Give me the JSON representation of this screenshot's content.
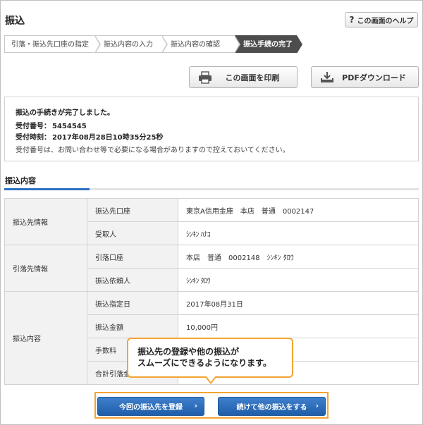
{
  "page": {
    "title": "振込"
  },
  "help": {
    "label": "この画面のヘルプ",
    "icon": "question-icon"
  },
  "steps": [
    {
      "label": "引落・振込先口座の指定",
      "active": false
    },
    {
      "label": "振込内容の入力",
      "active": false
    },
    {
      "label": "振込内容の確認",
      "active": false
    },
    {
      "label": "振込手続の完了",
      "active": true
    }
  ],
  "actions": {
    "print_label": "この画面を印刷",
    "pdf_label": "PDFダウンロード"
  },
  "completion": {
    "message": "振込の手続きが完了しました。",
    "receipt_no_label": "受付番号：",
    "receipt_no": "5454545",
    "receipt_time_label": "受付時刻：",
    "receipt_time": "2017年08月28日10時35分25秒",
    "note": "受付番号は、お問い合わせ等で必要になる場合がありますので控えておいてください。"
  },
  "details": {
    "section_title": "振込内容",
    "groups": {
      "payee": "振込先情報",
      "payer": "引落先情報",
      "content": "振込内容"
    },
    "rows": {
      "payee_account_h": "振込先口座",
      "payee_account_v": "東京A信用金庫　本店　普通　0002147",
      "recipient_h": "受取人",
      "recipient_v": "ｼﾝｷﾝ ﾊﾅｺ",
      "debit_account_h": "引落口座",
      "debit_account_v": "本店　普通　0002148　ｼﾝｷﾝ ﾀﾛｳ",
      "requester_h": "振込依頼人",
      "requester_v": "ｼﾝｷﾝ ﾀﾛｳ",
      "date_h": "振込指定日",
      "date_v": "2017年08月31日",
      "amount_h": "振込金額",
      "amount_v": "10,000円",
      "fee_h": "手数料",
      "total_h": "合計引落金額"
    }
  },
  "callout": {
    "line1": "振込先の登録や他の振込が",
    "line2": "スムーズにできるようになります。"
  },
  "bottom": {
    "register_label": "今回の振込先を登録",
    "continue_label": "続けて他の振込をする",
    "arrow": "›"
  },
  "colors": {
    "accent": "#2a72c2",
    "highlight": "#f3a433",
    "active_step": "#4d4d4d"
  }
}
